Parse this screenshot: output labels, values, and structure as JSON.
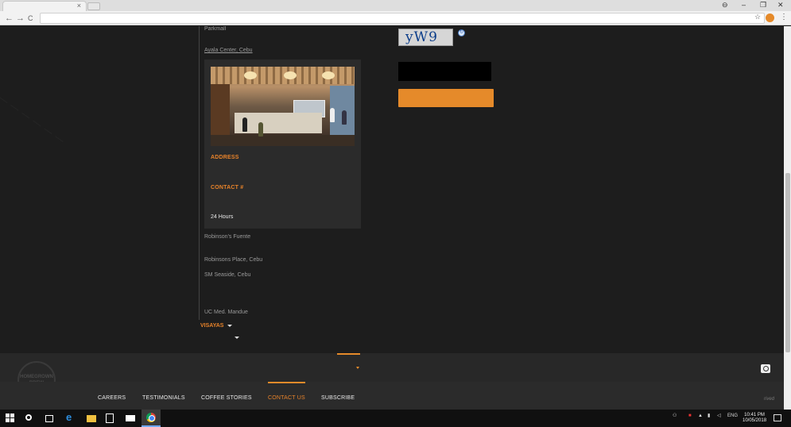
{
  "browser": {
    "tab_close": "×",
    "window_controls": {
      "account": "⊖",
      "minimize": "–",
      "restore": "❐",
      "close": "✕"
    },
    "nav": {
      "back": "←",
      "forward": "→",
      "reload": "C"
    },
    "icons": {
      "star": "☆",
      "menu": "⋮"
    },
    "extension_color": "#e58a2a"
  },
  "store_list": {
    "items_top": [
      "Parkmall",
      "Ayala Center, Cebu"
    ],
    "card": {
      "address_heading": "ADDRESS",
      "contact_heading": "CONTACT #",
      "hours": "24 Hours"
    },
    "items_bottom": [
      "Robinson's Fuente",
      "Robinsons Place, Cebu",
      "SM Seaside, Cebu",
      "UC Med. Mandue"
    ],
    "region": "VISAYAS"
  },
  "form": {
    "captcha_text": "yW9",
    "captcha_refresh": "↻",
    "submit_label": ""
  },
  "footer": {
    "badge_text": "HOMEGROWN BREW",
    "nav": {
      "careers": "CAREERS",
      "testimonials": "TESTIMONIALS",
      "coffee_stories": "COFFEE STORIES",
      "contact_us": "CONTACT US",
      "subscribe": "SUBSCRIBE"
    },
    "rights": "rived",
    "accent_color": "#e58a2a"
  },
  "taskbar": {
    "lang": "ENG",
    "time": "10:41 PM",
    "date": "10/05/2018"
  }
}
